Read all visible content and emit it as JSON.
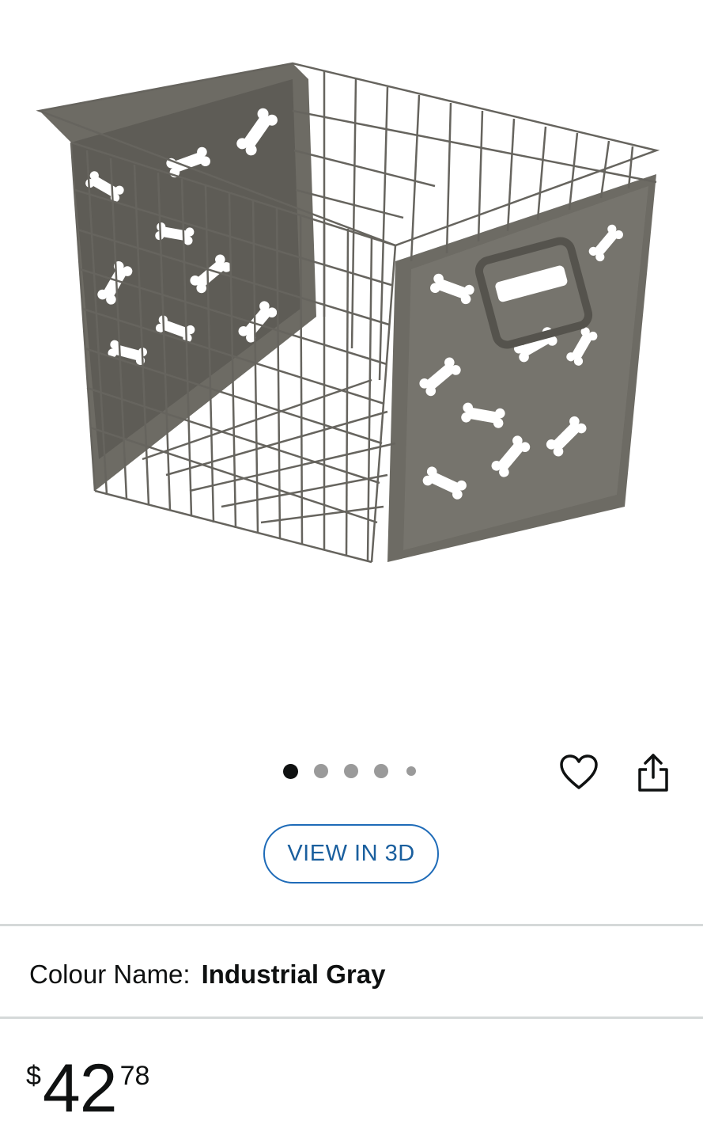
{
  "gallery": {
    "image_subject": "gray wire metal basket with bone-shaped cutouts",
    "dots_count": 5,
    "active_index": 0,
    "icons": {
      "wishlist": "heart-icon",
      "share": "share-icon"
    }
  },
  "view3d": {
    "label": "VIEW IN 3D"
  },
  "colour": {
    "label": "Colour Name:",
    "value": "Industrial Gray"
  },
  "price": {
    "currency": "$",
    "whole": "42",
    "fraction": "78"
  },
  "colors": {
    "accent_blue": "#1e6bb8",
    "basket": "#6d6b64",
    "divider": "#d5d9d9"
  }
}
